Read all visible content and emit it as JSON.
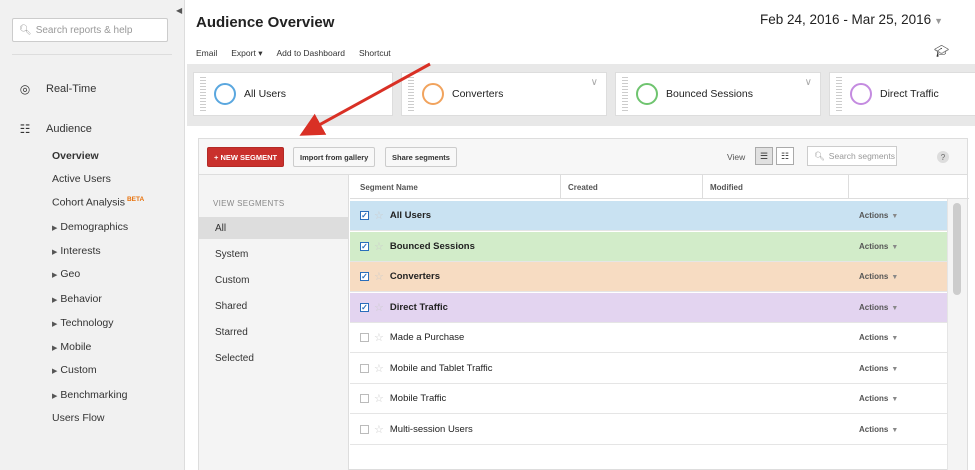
{
  "sidebar": {
    "search_placeholder": "Search reports & help",
    "realtime": "Real-Time",
    "audience": "Audience",
    "items": [
      {
        "label": "Overview",
        "arrow": false,
        "bold": true
      },
      {
        "label": "Active Users",
        "arrow": false
      },
      {
        "label": "Cohort Analysis",
        "badge": "BETA",
        "arrow": false
      },
      {
        "label": "Demographics",
        "arrow": true
      },
      {
        "label": "Interests",
        "arrow": true
      },
      {
        "label": "Geo",
        "arrow": true
      },
      {
        "label": "Behavior",
        "arrow": true
      },
      {
        "label": "Technology",
        "arrow": true
      },
      {
        "label": "Mobile",
        "arrow": true
      },
      {
        "label": "Custom",
        "arrow": true
      },
      {
        "label": "Benchmarking",
        "arrow": true
      },
      {
        "label": "Users Flow",
        "arrow": false
      }
    ]
  },
  "header": {
    "title": "Audience Overview",
    "date_range": "Feb 24, 2016 - Mar 25, 2016",
    "toolbar": [
      "Email",
      "Export ▾",
      "Add to Dashboard",
      "Shortcut"
    ]
  },
  "segments_bar": [
    {
      "label": "All Users",
      "color": "#5aa7df"
    },
    {
      "label": "Converters",
      "color": "#f1a35d"
    },
    {
      "label": "Bounced Sessions",
      "color": "#6fc46f"
    },
    {
      "label": "Direct Traffic",
      "color": "#c48be0"
    }
  ],
  "panel": {
    "new_segment": "+ NEW SEGMENT",
    "import_gallery": "Import from gallery",
    "share_segments": "Share segments",
    "view_label": "View",
    "search_placeholder": "Search segments",
    "view_segments_title": "VIEW SEGMENTS",
    "view_segments": [
      "All",
      "System",
      "Custom",
      "Shared",
      "Starred",
      "Selected"
    ],
    "columns": [
      "Segment Name",
      "Created",
      "Modified"
    ],
    "actions_label": "Actions",
    "rows": [
      {
        "name": "All Users",
        "checked": true,
        "bg": "#c9e2f2"
      },
      {
        "name": "Bounced Sessions",
        "checked": true,
        "bg": "#d2ecc9"
      },
      {
        "name": "Converters",
        "checked": true,
        "bg": "#f7dcc2"
      },
      {
        "name": "Direct Traffic",
        "checked": true,
        "bg": "#e3d4f0"
      },
      {
        "name": "Made a Purchase",
        "checked": false,
        "bg": "#ffffff"
      },
      {
        "name": "Mobile and Tablet Traffic",
        "checked": false,
        "bg": "#ffffff"
      },
      {
        "name": "Mobile Traffic",
        "checked": false,
        "bg": "#ffffff"
      },
      {
        "name": "Multi-session Users",
        "checked": false,
        "bg": "#ffffff"
      }
    ]
  }
}
